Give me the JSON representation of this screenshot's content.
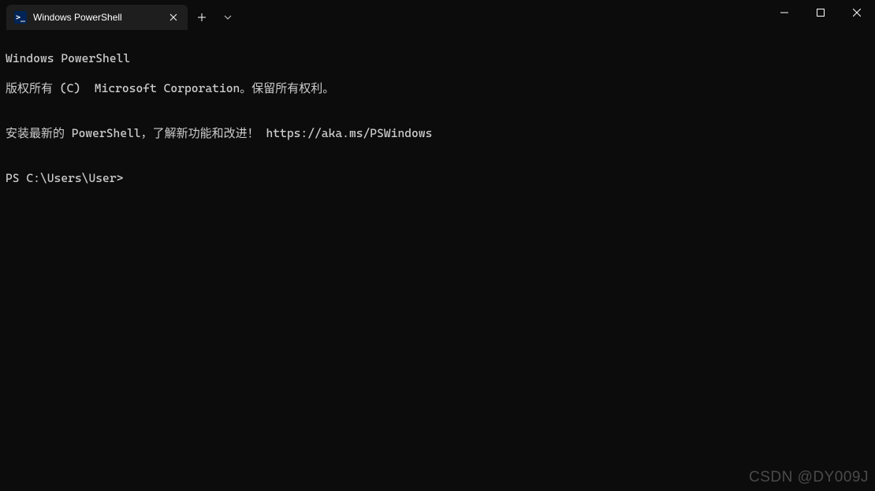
{
  "titlebar": {
    "tab": {
      "title": "Windows PowerShell",
      "icon_text": ">_"
    }
  },
  "terminal": {
    "line1": "Windows PowerShell",
    "line2": "版权所有 (C)  Microsoft Corporation。保留所有权利。",
    "line3": "",
    "line4": "安装最新的 PowerShell，了解新功能和改进！ https://aka.ms/PSWindows",
    "line5": "",
    "prompt": "PS C:\\Users\\User>"
  },
  "watermark": "CSDN @DY009J"
}
